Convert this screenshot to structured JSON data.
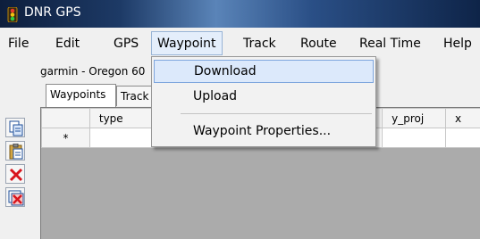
{
  "window": {
    "title": "DNR GPS"
  },
  "menubar": {
    "items": [
      "File",
      "Edit",
      "GPS",
      "Waypoint",
      "Track",
      "Route",
      "Real Time",
      "Help"
    ]
  },
  "device": {
    "label": "garmin - Oregon 60"
  },
  "tabs": [
    "Waypoints",
    "Track"
  ],
  "grid": {
    "columns": [
      "type",
      "",
      "",
      "",
      "y_proj",
      "x"
    ],
    "new_row_marker": "*"
  },
  "dropdown": {
    "items": [
      "Download",
      "Upload",
      "Waypoint Properties..."
    ]
  },
  "icons": {
    "app": "traffic-light-icon",
    "tools": [
      "copy-icon",
      "paste-icon",
      "delete-icon",
      "delete-all-icon"
    ]
  },
  "colors": {
    "menu_hover": "#dce9fb",
    "menu_hover_border": "#7ea6de",
    "grid_background": "#ababab"
  }
}
